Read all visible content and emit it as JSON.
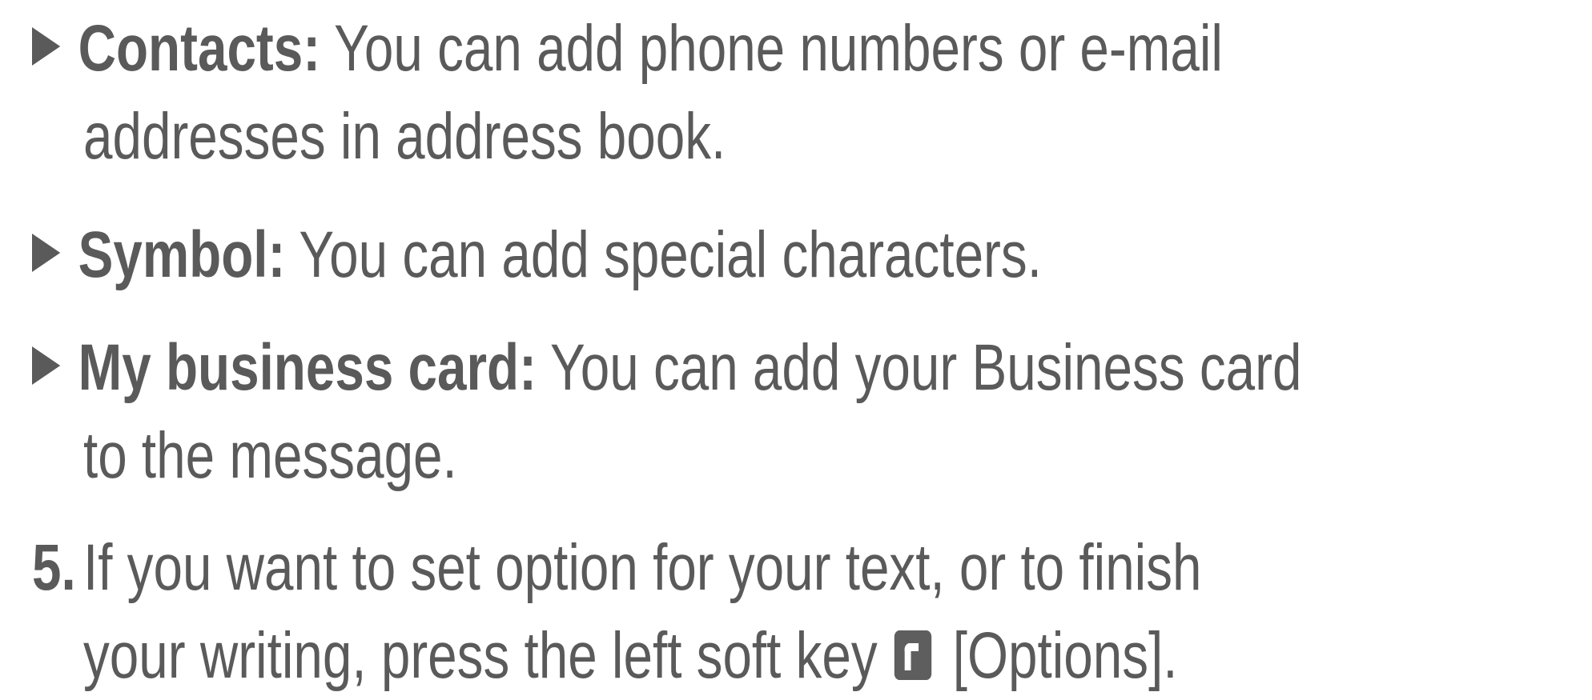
{
  "items": [
    {
      "term": "Contacts:",
      "line1": " You can add phone numbers or e-mail",
      "line2": "addresses in address book."
    },
    {
      "term": "Symbol:",
      "line1": " You can add special characters."
    },
    {
      "term": "My business card:",
      "line1": " You can add your Business card",
      "line2": "to the message."
    }
  ],
  "step": {
    "number": "5.",
    "line1": "If you want to set option for your text, or to finish",
    "line2_before": "your writing, press the left soft key",
    "line2_after": "[Options].",
    "icon": "left-soft-key-icon"
  }
}
